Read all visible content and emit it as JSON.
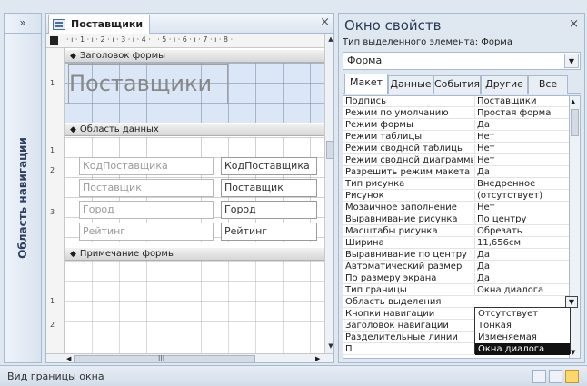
{
  "nav": {
    "toggle": "»",
    "label": "Область навигации"
  },
  "document": {
    "tab_label": "Поставщики",
    "close": "×",
    "ruler_h": "· ı · 1 · ı · 2 · ı · 3 · ı · 4 · ı · 5 · ı · 6 · ı · 7 · ı · 8 ·",
    "ruler_v": [
      "1",
      "1",
      "2",
      "3",
      "1",
      "2"
    ],
    "sections": {
      "header": "Заголовок формы",
      "detail": "Область данных",
      "footer": "Примечание формы"
    },
    "header_title": "Поставщики",
    "fields": [
      {
        "label": "КодПоставщика",
        "control": "КодПоставщика"
      },
      {
        "label": "Поставщик",
        "control": "Поставщик"
      },
      {
        "label": "Город",
        "control": "Город"
      },
      {
        "label": "Рейтинг",
        "control": "Рейтинг"
      }
    ],
    "hscroll_grip": "III"
  },
  "props": {
    "title": "Окно свойств",
    "close": "×",
    "selection_type": "Тип выделенного элемента:  Форма",
    "object": "Форма",
    "tabs": [
      "Макет",
      "Данные",
      "События",
      "Другие",
      "Все"
    ],
    "active_tab": "Макет",
    "rows": [
      {
        "name": "Подпись",
        "value": "Поставщики"
      },
      {
        "name": "Режим по умолчанию",
        "value": "Простая форма"
      },
      {
        "name": "Режим формы",
        "value": "Да"
      },
      {
        "name": "Режим таблицы",
        "value": "Нет"
      },
      {
        "name": "Режим сводной таблицы",
        "value": "Нет"
      },
      {
        "name": "Режим сводной диаграммы",
        "value": "Нет"
      },
      {
        "name": "Разрешить режим макета",
        "value": "Да"
      },
      {
        "name": "Тип рисунка",
        "value": "Внедренное"
      },
      {
        "name": "Рисунок",
        "value": "(отсутствует)"
      },
      {
        "name": "Мозаичное заполнение",
        "value": "Нет"
      },
      {
        "name": "Выравнивание рисунка",
        "value": "По центру"
      },
      {
        "name": "Масштабы рисунка",
        "value": "Обрезать"
      },
      {
        "name": "Ширина",
        "value": "11,656см"
      },
      {
        "name": "Выравнивание по центру",
        "value": "Да"
      },
      {
        "name": "Автоматический размер",
        "value": "Да"
      },
      {
        "name": "По размеру экрана",
        "value": "Да"
      },
      {
        "name": "Тип границы",
        "value": "Окна диалога"
      },
      {
        "name": "Область выделения",
        "value": ""
      },
      {
        "name": "Кнопки навигации",
        "value": ""
      },
      {
        "name": "Заголовок навигации",
        "value": ""
      },
      {
        "name": "Разделительные линии",
        "value": ""
      },
      {
        "name": "П",
        "value": ""
      }
    ],
    "border_options": [
      "Отсутствует",
      "Тонкая",
      "Изменяемая",
      "Окна диалога"
    ],
    "border_selected": "Окна диалога"
  },
  "status": {
    "text": "Вид границы окна"
  }
}
